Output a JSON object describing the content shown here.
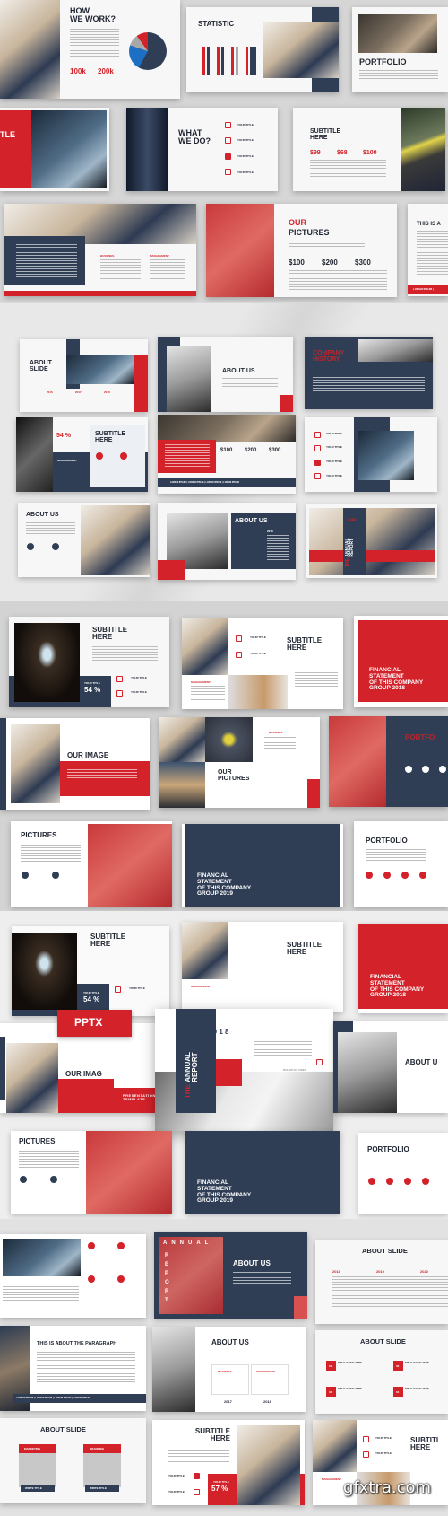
{
  "section1": {
    "how_we_work": {
      "title": "HOW\nWE WORK?",
      "stat_a": "100k",
      "stat_b": "200k"
    },
    "statistic": {
      "title": "STATISTIC"
    },
    "portfolio": {
      "title": "PORTFOLIO"
    },
    "title_crop": {
      "title": "TLE"
    },
    "what_we_do": {
      "title": "WHAT\nWE DO?",
      "items": [
        "YOUR TITLE",
        "YOUR TITLE",
        "YOUR TITLE",
        "YOUR TITLE"
      ]
    },
    "subtitle_prices": {
      "title": "SUBTITLE\nHERE",
      "prices": [
        "$99",
        "$68",
        "$100"
      ]
    },
    "team": {
      "col_a": "BUSSINES",
      "col_b": "MANAGEMENT"
    },
    "our_pictures": {
      "title_a": "OUR",
      "title_b": "PICTURES",
      "prices": [
        "$100",
        "$200",
        "$300"
      ]
    },
    "this_is": {
      "title": "THIS IS A",
      "footer": "LOREM IPSUM |"
    }
  },
  "section2": {
    "about_slide": {
      "title": "ABOUT\nSLIDE",
      "years": [
        "2016",
        "2017",
        "2018"
      ]
    },
    "about_us_a": {
      "title": "ABOUT US"
    },
    "company_history": {
      "title": "COMPANY\nHISTORY"
    },
    "subtitle_54": {
      "percent": "54 %",
      "title": "SUBTITLE\nHERE",
      "label": "MANAGEMENT"
    },
    "prices": {
      "prices": [
        "$100",
        "$200",
        "$300"
      ],
      "footer": "LOREM IPSUM | LOREM IPSUM | LOREM IPSUM | LOREM IPSUM"
    },
    "your_titles": {
      "items": [
        "YOUR TITLE",
        "YOUR TITLE",
        "YOUR TITLE",
        "YOUR TITLE"
      ]
    },
    "about_us_b": {
      "title": "ABOUT US"
    },
    "about_us_c": {
      "title": "ABOUT US",
      "year": "2018"
    },
    "annual": {
      "the": "THE",
      "title": "ANNUAL\nREPORT",
      "year": "2018"
    }
  },
  "section3": {
    "subtitle_a": {
      "title": "SUBTITLE\nHERE",
      "label": "YOUR TITLE",
      "percent": "54 %",
      "items": [
        "YOUR TITLE",
        "YOUR TITLE"
      ]
    },
    "subtitle_b": {
      "title": "SUBTITLE\nHERE",
      "label": "MANAGEMENT",
      "items": [
        "YOUR TITLE",
        "YOUR TITLE"
      ]
    },
    "financial_2018": {
      "title": "FINANCIAL\nSTATEMENT\nOF THIS COMPANY\nGROUP 2018"
    },
    "our_image": {
      "title": "OUR IMAGE"
    },
    "our_pictures": {
      "title": "OUR\nPICTURES",
      "label": "BUSSINES"
    },
    "portfolio_red": {
      "title": "PORTFO"
    },
    "pictures": {
      "title": "PICTURES"
    },
    "financial_2019": {
      "title": "FINANCIAL\nSTATEMENT\nOF THIS COMPANY\nGROUP 2019"
    },
    "portfolio": {
      "title": "PORTFOLIO"
    }
  },
  "section4": {
    "subtitle_a": {
      "title": "SUBTITLE\nHERE",
      "label": "YOUR TITLE",
      "percent": "54 %",
      "items": [
        "YOUR TITLE",
        "YOUR TITLE"
      ]
    },
    "subtitle_b": {
      "title": "SUBTITLE\nHERE",
      "label": "MANAGEMENT"
    },
    "financial_2018": {
      "title": "FINANCIAL\nSTATEMENT\nOF THIS COMPANY\nGROUP 2018"
    },
    "pptx": "PPTX",
    "our_image": {
      "title": "OUR IMAG"
    },
    "presentation": "PRESENTATION\nTEMPLATE",
    "annual": {
      "the": "THE",
      "title": "ANNUAL\nREPORT",
      "year": "2 0 1 8",
      "caption": "DOLOR SIT AMET"
    },
    "about_u": {
      "title": "ABOUT U"
    },
    "pictures": {
      "title": "PICTURES"
    },
    "financial_2019": {
      "title": "FINANCIAL\nSTATEMENT\nOF THIS COMPANY\nGROUP 2019"
    },
    "portfolio": {
      "title": "PORTFOLIO"
    }
  },
  "section5": {
    "icons_slide": {},
    "annual_about": {
      "vertical_a": "ANNUAL",
      "vertical_b": "REPORT",
      "title": "ABOUT US"
    },
    "about_slide_years": {
      "title": "ABOUT SLIDE",
      "years": [
        "2018",
        "2019",
        "2020"
      ]
    },
    "paragraph": {
      "title": "THIS IS ABOUT THE PARAGRAPH",
      "footer": "LOREM IPSUM | LOREM IPSUM | LOREM IPSUM | LOREM IPSUM"
    },
    "about_us": {
      "title": "ABOUT US",
      "col_a": "BUSSINES",
      "col_b": "MANAGEMENT",
      "years": [
        "2017",
        "2018"
      ]
    },
    "about_slide_list": {
      "title": "ABOUT SLIDE",
      "items": [
        {
          "n": "01",
          "t": "TITLE GOES HERE"
        },
        {
          "n": "02",
          "t": "TITLE GOES HERE"
        },
        {
          "n": "03",
          "t": "TITLE GOES HERE"
        },
        {
          "n": "04",
          "t": "TITLE GOES HERE"
        }
      ]
    },
    "about_slide_cards": {
      "title": "ABOUT SLIDE",
      "cards": [
        "MARKETING",
        "BRANDING"
      ],
      "buttons": [
        "WRITE TITLE",
        "WRITE TITLE"
      ]
    },
    "subtitle_57": {
      "title": "SUBTITLE\nHERE",
      "items": [
        "YOUR TITLE",
        "YOUR TITLE"
      ],
      "label": "YOUR TITLE",
      "percent": "57 %"
    },
    "subtitle_crop": {
      "title": "SUBTITL\nHERE",
      "items": [
        "YOUR TITLE",
        "YOUR TITLE"
      ],
      "label": "MANAGEMENT"
    }
  },
  "watermark": "gfxtra.com",
  "colors": {
    "navy": "#2f3e55",
    "red": "#d3222a",
    "background": "#dcdcdc"
  }
}
